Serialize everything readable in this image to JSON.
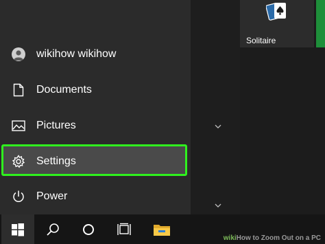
{
  "start_menu": {
    "items": [
      {
        "label": "wikihow wikihow",
        "icon": "user-avatar"
      },
      {
        "label": "Documents",
        "icon": "document-icon"
      },
      {
        "label": "Pictures",
        "icon": "pictures-icon"
      },
      {
        "label": "Settings",
        "icon": "gear-icon"
      },
      {
        "label": "Power",
        "icon": "power-icon"
      }
    ],
    "highlight_color": "#2ff21e"
  },
  "tiles": [
    {
      "label": "Solitaire",
      "icon": "solitaire-cards-icon"
    }
  ],
  "taskbar": {
    "buttons": [
      "windows-start-icon",
      "search-icon",
      "cortana-icon",
      "task-view-icon",
      "file-explorer-icon"
    ]
  },
  "watermark": {
    "brand": "wiki",
    "text": "How to Zoom Out on a PC"
  }
}
